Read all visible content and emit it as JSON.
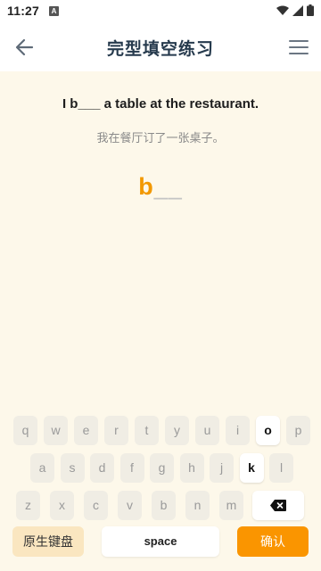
{
  "status": {
    "time": "11:27",
    "notif_icon": "a-app-icon"
  },
  "header": {
    "title": "完型填空练习"
  },
  "question": {
    "sentence": "I b___ a table at the restaurant.",
    "translation": "我在餐厅订了一张桌子。",
    "answer_typed": "b",
    "answer_blank": "__"
  },
  "keyboard": {
    "row1": [
      "q",
      "w",
      "e",
      "r",
      "t",
      "y",
      "u",
      "i",
      "o",
      "p"
    ],
    "row2": [
      "a",
      "s",
      "d",
      "f",
      "g",
      "h",
      "j",
      "k",
      "l"
    ],
    "row3": [
      "z",
      "x",
      "c",
      "v",
      "b",
      "n",
      "m"
    ],
    "highlighted": [
      "o",
      "k"
    ],
    "native_label": "原生键盘",
    "space_label": "space",
    "confirm_label": "确认"
  },
  "colors": {
    "accent": "#fa9500",
    "answer": "#f29800",
    "title": "#263a4d"
  }
}
